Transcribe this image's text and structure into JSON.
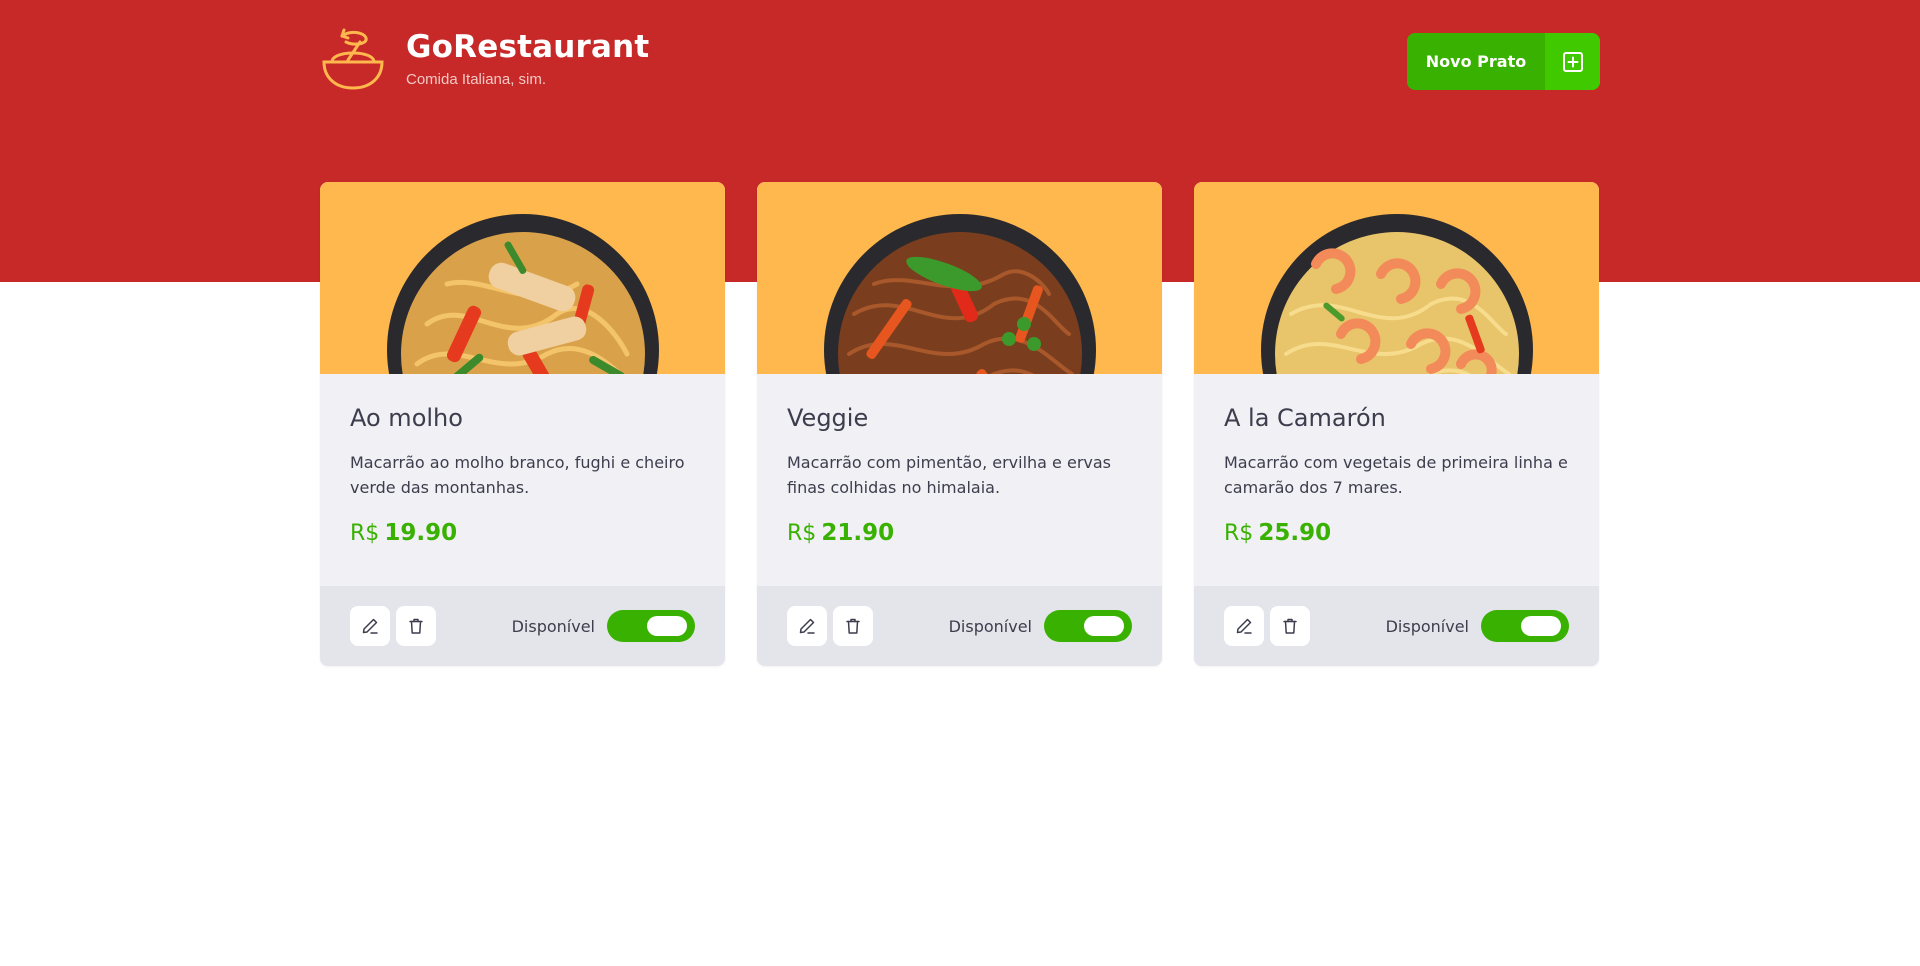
{
  "header": {
    "title": "GoRestaurant",
    "subtitle": "Comida Italiana, sim.",
    "logo_icon": "bowl-logo-icon",
    "new_dish_label": "Novo Prato",
    "new_dish_icon": "plus-square-icon"
  },
  "colors": {
    "hero_bg": "#c72828",
    "accent_green": "#39b100",
    "card_image_bg": "#ffb84d",
    "card_bg": "#f0f0f5",
    "card_footer_bg": "#e4e4eb",
    "text": "#3d3d4d"
  },
  "dishes": [
    {
      "name": "Ao molho",
      "description": "Macarrão ao molho branco, fughi e cheiro verde das montanhas.",
      "currency": "R$",
      "price": "19.90",
      "available_label": "Disponível",
      "available": true
    },
    {
      "name": "Veggie",
      "description": "Macarrão com pimentão, ervilha e ervas finas colhidas no himalaia.",
      "currency": "R$",
      "price": "21.90",
      "available_label": "Disponível",
      "available": true
    },
    {
      "name": "A la Camarón",
      "description": "Macarrão com vegetais de primeira linha e camarão dos 7 mares.",
      "currency": "R$",
      "price": "25.90",
      "available_label": "Disponível",
      "available": true
    }
  ]
}
